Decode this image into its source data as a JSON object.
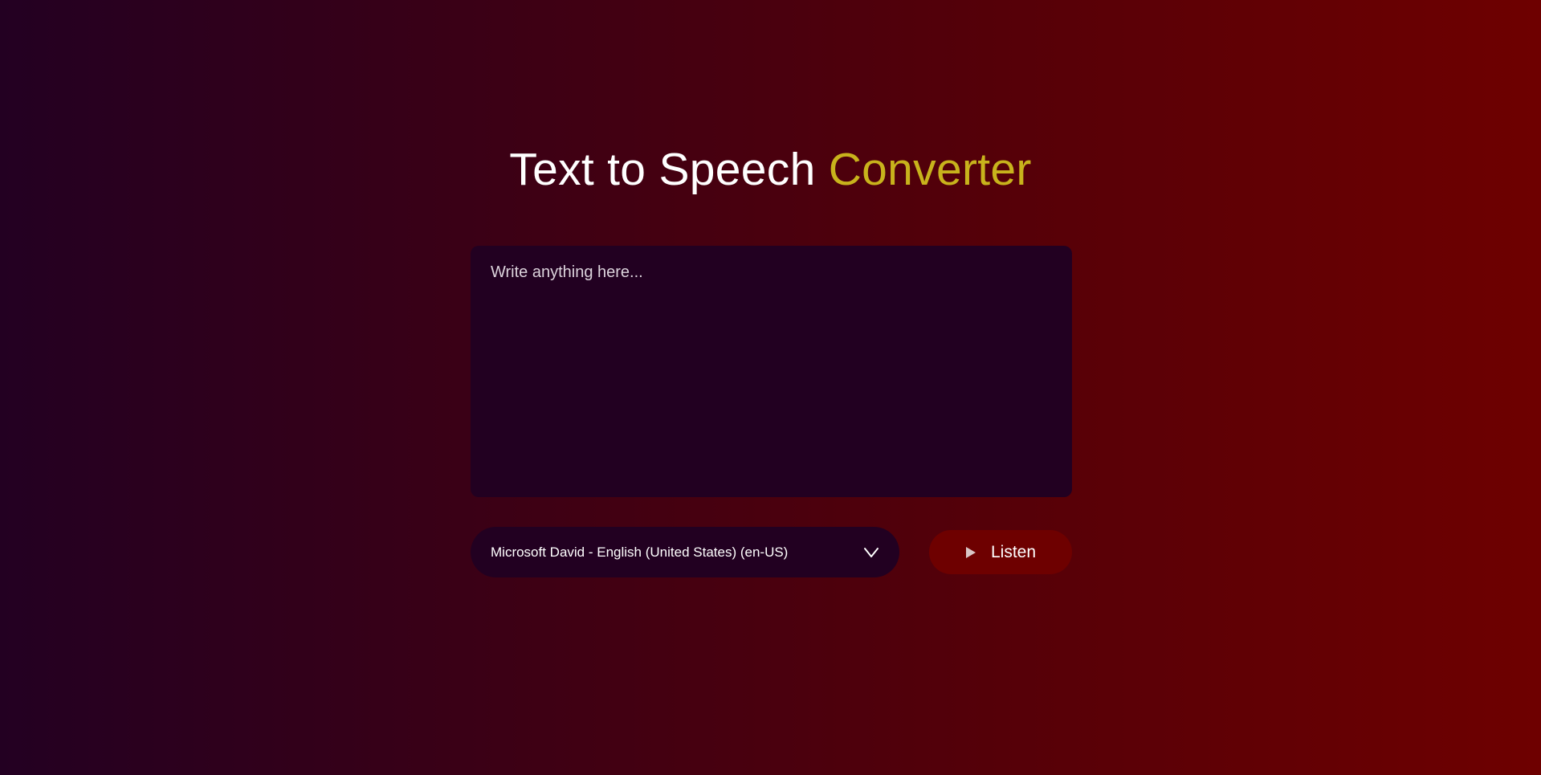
{
  "header": {
    "title_main": "Text to Speech",
    "title_accent": "Converter"
  },
  "editor": {
    "placeholder": "Write anything here...",
    "value": ""
  },
  "voice": {
    "selected": "Microsoft David - English (United States) (en-US)"
  },
  "actions": {
    "listen_label": "Listen"
  },
  "icons": {
    "dropdown": "chevron-down-icon",
    "play": "play-icon"
  },
  "colors": {
    "accent": "#c8b31c",
    "panel": "#220021",
    "button": "#6e0000"
  }
}
